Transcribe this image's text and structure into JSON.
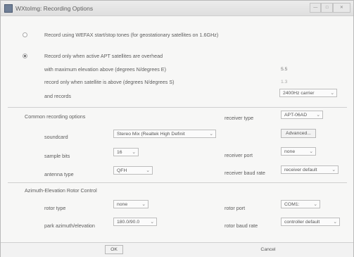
{
  "window": {
    "title": "WXtoImg: Recording Options"
  },
  "title_buttons": {
    "minimize": "—",
    "maximize": "□",
    "close": "✕"
  },
  "mode": {
    "wefax_label": "Record using WEFAX start/stop tones (for geostationary satellites on 1.6GHz)",
    "apt_label": "Record only when active APT satellites are overhead",
    "selected": "apt"
  },
  "apt": {
    "max_elev_label": "with maximum elevation above (degrees N/degrees E)",
    "max_elev_value": "5.5",
    "min_elev_label": "record only when satellite is above (degrees N/degrees S)",
    "min_elev_value": "1.3",
    "and_records_label": "and records",
    "records_option": "2400Hz carrier"
  },
  "common": {
    "heading": "Common recording options",
    "soundcard_label": "soundcard",
    "soundcard_value": "Stereo Mix (Realtek High Definit",
    "sample_bits_label": "sample bits",
    "sample_bits_value": "16",
    "antenna_type_label": "antenna type",
    "antenna_type_value": "QFH",
    "receiver_type_label": "receiver type",
    "receiver_type_value": "APT-06AD",
    "advanced_label": "Advanced...",
    "receiver_port_label": "receiver port",
    "receiver_port_value": "none",
    "receiver_baud_label": "receiver baud rate",
    "receiver_baud_value": "receiver default"
  },
  "rotor": {
    "heading": "Azimuth-Elevation Rotor Control",
    "rotor_type_label": "rotor type",
    "rotor_type_value": "none",
    "park_label": "park azimuth/elevation",
    "park_value": "180.0/90.0",
    "rotor_port_label": "rotor port",
    "rotor_port_value": "COM1:",
    "rotor_baud_label": "rotor baud rate",
    "rotor_baud_value": "controller default"
  },
  "buttons": {
    "ok": "OK",
    "cancel": "Cancel"
  }
}
